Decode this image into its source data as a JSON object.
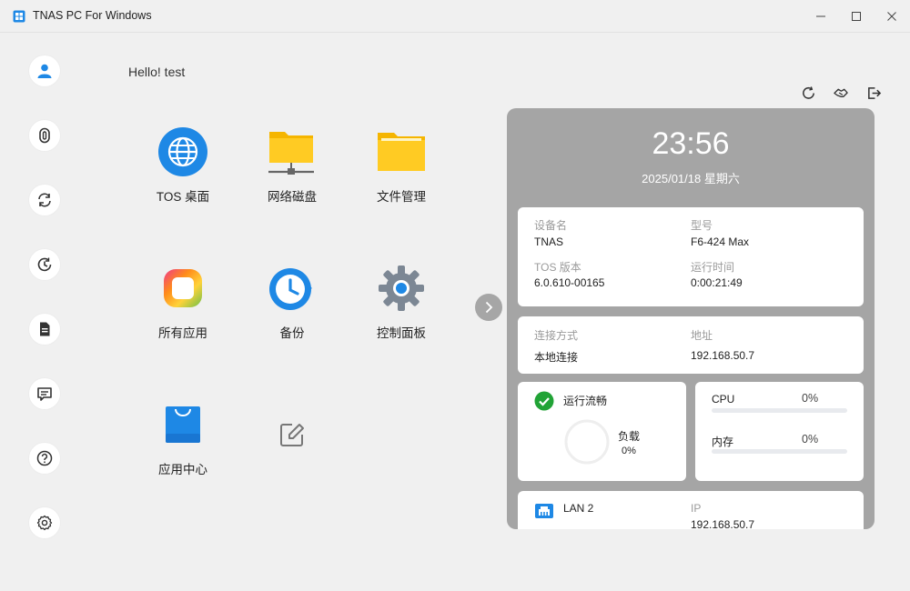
{
  "window": {
    "title": "TNAS PC For Windows"
  },
  "greeting": "Hello! test",
  "apps": [
    {
      "label": "TOS 桌面"
    },
    {
      "label": "网络磁盘"
    },
    {
      "label": "文件管理"
    },
    {
      "label": "所有应用"
    },
    {
      "label": "备份"
    },
    {
      "label": "控制面板"
    },
    {
      "label": "应用中心"
    }
  ],
  "panel": {
    "time": "23:56",
    "date": "2025/01/18 星期六",
    "device": {
      "name_label": "设备名",
      "name_value": "TNAS",
      "model_label": "型号",
      "model_value": "F6-424 Max",
      "tos_label": "TOS 版本",
      "tos_value": "6.0.610-00165",
      "uptime_label": "运行时间",
      "uptime_value": "0:00:21:49"
    },
    "connection": {
      "method_label": "连接方式",
      "method_value": "本地连接",
      "address_label": "地址",
      "address_value": "192.168.50.7"
    },
    "status": {
      "label": "运行流畅",
      "load_label": "负载",
      "load_value": "0%"
    },
    "resources": {
      "cpu_label": "CPU",
      "cpu_value": "0%",
      "mem_label": "内存",
      "mem_value": "0%"
    },
    "network": {
      "lan_label": "LAN 2",
      "ip_label": "IP",
      "ip_value_partial": "192.168.50.7"
    }
  },
  "colors": {
    "accent": "#1e88e5",
    "ok": "#21a336",
    "panel_bg": "#a5a5a5"
  }
}
